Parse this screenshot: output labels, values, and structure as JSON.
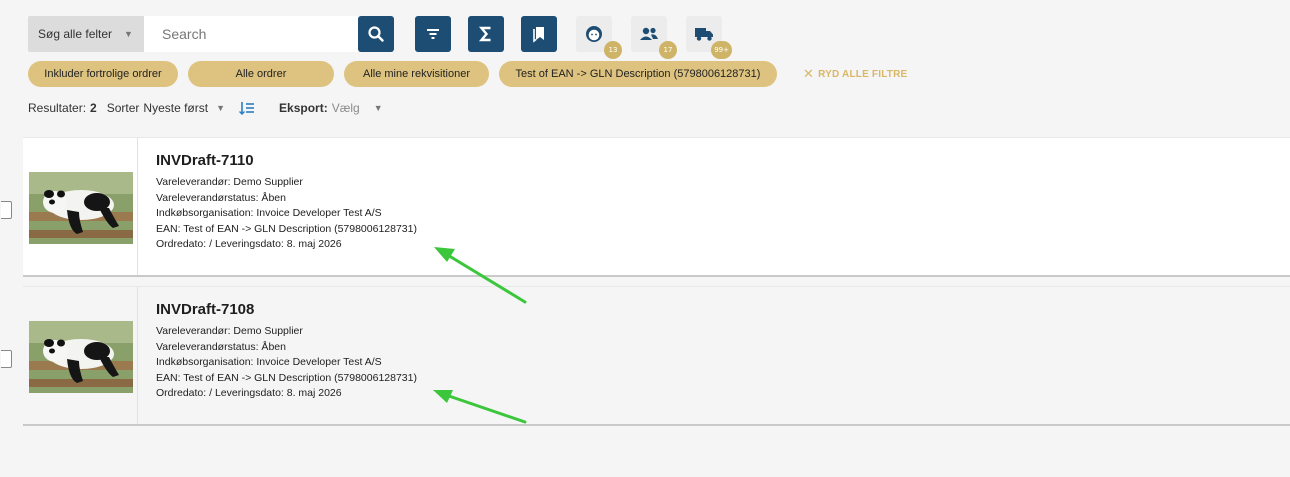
{
  "toolbar": {
    "field_select": "Søg alle felter",
    "search_placeholder": "Search",
    "badges": {
      "user": "13",
      "group": "17",
      "truck": "99+"
    }
  },
  "filters": {
    "chips": [
      "Inkluder fortrolige ordrer",
      "Alle ordrer",
      "Alle mine rekvisitioner",
      "Test of EAN -> GLN Description (5798006128731)"
    ],
    "clear_label": "RYD ALLE FILTRE"
  },
  "results": {
    "label": "Resultater:",
    "count": "2",
    "sort_label": "Sorter",
    "sort_value": "Nyeste først",
    "export_label": "Eksport:",
    "export_value": "Vælg"
  },
  "orders": [
    {
      "title": "INVDraft-7110",
      "supplier": "Vareleverandør: Demo Supplier",
      "supplier_status": "Vareleverandørstatus: Åben",
      "organisation": "Indkøbsorganisation: Invoice Developer Test A/S",
      "ean": "EAN: Test of EAN -> GLN Description (5798006128731)",
      "dates": "Ordredato: / Leveringsdato: 8. maj 2026"
    },
    {
      "title": "INVDraft-7108",
      "supplier": "Vareleverandør: Demo Supplier",
      "supplier_status": "Vareleverandørstatus: Åben",
      "organisation": "Indkøbsorganisation: Invoice Developer Test A/S",
      "ean": "EAN: Test of EAN -> GLN Description (5798006128731)",
      "dates": "Ordredato: / Leveringsdato: 8. maj 2026"
    }
  ],
  "colors": {
    "primary_button": "#1e4d73",
    "chip": "#ddc37f",
    "badge": "#cfb468",
    "annotation_arrow": "#3cc63c"
  }
}
